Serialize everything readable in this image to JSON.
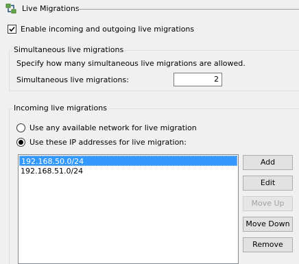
{
  "header": {
    "title": "Live Migrations",
    "icon": "server-migration-icon"
  },
  "enable_checkbox": {
    "label": "Enable incoming and outgoing live migrations",
    "checked": true
  },
  "simultaneous": {
    "group_title": "Simultaneous live migrations",
    "description": "Specify how many simultaneous live migrations are allowed.",
    "field_label": "Simultaneous live migrations:",
    "value": "2"
  },
  "incoming": {
    "group_title": "Incoming live migrations",
    "options": [
      {
        "label": "Use any available network for live migration",
        "selected": false
      },
      {
        "label": "Use these IP addresses for live migration:",
        "selected": true
      }
    ],
    "ip_list": [
      {
        "value": "192.168.50.0/24",
        "selected": true
      },
      {
        "value": "192.168.51.0/24",
        "selected": false
      }
    ]
  },
  "buttons": {
    "add": "Add",
    "edit": "Edit",
    "move_up": "Move Up",
    "move_down": "Move Down",
    "remove": "Remove"
  },
  "colors": {
    "selection": "#3399ff",
    "accent_icon": "#4a8a3a"
  }
}
